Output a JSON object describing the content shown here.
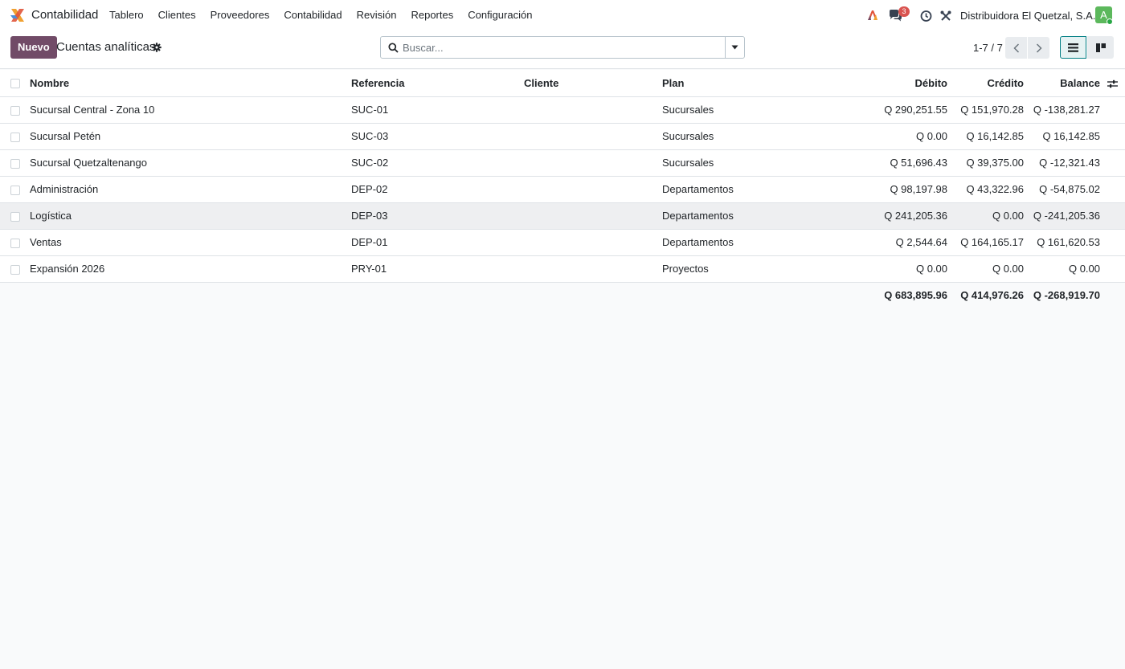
{
  "app": {
    "name": "Contabilidad",
    "brand_color": "#714b67",
    "accent_color": "#017e84"
  },
  "menu": {
    "items": [
      "Tablero",
      "Clientes",
      "Proveedores",
      "Contabilidad",
      "Revisión",
      "Reportes",
      "Configuración"
    ]
  },
  "systray": {
    "chat_badge": "3",
    "company": "Distribuidora El Quetzal, S.A.",
    "avatar_initial": "A",
    "icons": [
      "ai-icon",
      "chat-icon",
      "clock-icon",
      "tools-icon"
    ]
  },
  "control": {
    "new_label": "Nuevo",
    "title": "Cuentas analíticas",
    "search_placeholder": "Buscar...",
    "pager": "1-7 / 7"
  },
  "table": {
    "columns": {
      "name": "Nombre",
      "reference": "Referencia",
      "client": "Cliente",
      "plan": "Plan",
      "debit": "Débito",
      "credit": "Crédito",
      "balance": "Balance"
    },
    "rows": [
      {
        "name": "Sucursal Central - Zona 10",
        "reference": "SUC-01",
        "client": "",
        "plan": "Sucursales",
        "debit": "Q 290,251.55",
        "credit": "Q 151,970.28",
        "balance": "Q -138,281.27"
      },
      {
        "name": "Sucursal Petén",
        "reference": "SUC-03",
        "client": "",
        "plan": "Sucursales",
        "debit": "Q 0.00",
        "credit": "Q 16,142.85",
        "balance": "Q 16,142.85"
      },
      {
        "name": "Sucursal Quetzaltenango",
        "reference": "SUC-02",
        "client": "",
        "plan": "Sucursales",
        "debit": "Q 51,696.43",
        "credit": "Q 39,375.00",
        "balance": "Q -12,321.43"
      },
      {
        "name": "Administración",
        "reference": "DEP-02",
        "client": "",
        "plan": "Departamentos",
        "debit": "Q 98,197.98",
        "credit": "Q 43,322.96",
        "balance": "Q -54,875.02"
      },
      {
        "name": "Logística",
        "reference": "DEP-03",
        "client": "",
        "plan": "Departamentos",
        "debit": "Q 241,205.36",
        "credit": "Q 0.00",
        "balance": "Q -241,205.36"
      },
      {
        "name": "Ventas",
        "reference": "DEP-01",
        "client": "",
        "plan": "Departamentos",
        "debit": "Q 2,544.64",
        "credit": "Q 164,165.17",
        "balance": "Q 161,620.53"
      },
      {
        "name": "Expansión 2026",
        "reference": "PRY-01",
        "client": "",
        "plan": "Proyectos",
        "debit": "Q 0.00",
        "credit": "Q 0.00",
        "balance": "Q 0.00"
      }
    ],
    "totals": {
      "debit": "Q 683,895.96",
      "credit": "Q 414,976.26",
      "balance": "Q -268,919.70"
    }
  }
}
